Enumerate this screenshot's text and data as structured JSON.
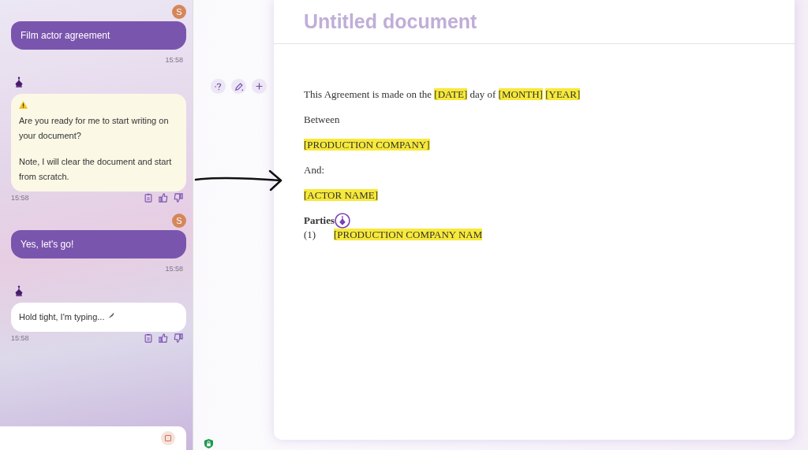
{
  "chat": {
    "messages": [
      {
        "kind": "user",
        "avatar": "S",
        "text": "Film actor agreement",
        "time": "15:58"
      },
      {
        "kind": "bot",
        "warning": true,
        "paragraphs": [
          "Are you ready for me to start writing on your document?",
          "Note, I will clear the document and start from scratch."
        ],
        "time": "15:58",
        "typing": false
      },
      {
        "kind": "user",
        "avatar": "S",
        "text": "Yes, let's go!",
        "time": "15:58"
      },
      {
        "kind": "bot",
        "warning": false,
        "paragraphs": [
          "Hold tight, I'm typing..."
        ],
        "time": "15:58",
        "typing": true
      }
    ]
  },
  "document": {
    "title": "Untitled document",
    "blocks": [
      {
        "kind": "para",
        "parts": [
          {
            "text": "This Agreement is made on the ",
            "highlight": false
          },
          {
            "text": "[DATE]",
            "highlight": true
          },
          {
            "text": " day of ",
            "highlight": false
          },
          {
            "text": "[MONTH]",
            "highlight": true
          },
          {
            "text": "[YEAR]",
            "highlight": true,
            "space_before": true
          }
        ]
      },
      {
        "kind": "para",
        "parts": [
          {
            "text": "Between",
            "highlight": false
          }
        ]
      },
      {
        "kind": "para",
        "parts": [
          {
            "text": "[PRODUCTION COMPANY]",
            "highlight": true
          }
        ]
      },
      {
        "kind": "para",
        "parts": [
          {
            "text": "And:",
            "highlight": false
          }
        ]
      },
      {
        "kind": "para",
        "parts": [
          {
            "text": "[ACTOR NAME]",
            "highlight": true
          }
        ]
      },
      {
        "kind": "heading",
        "text": "Parties"
      },
      {
        "kind": "item",
        "number": "(1)",
        "parts": [
          {
            "text": "[PRODUCTION COMPANY NAM",
            "highlight": true
          }
        ]
      }
    ]
  }
}
